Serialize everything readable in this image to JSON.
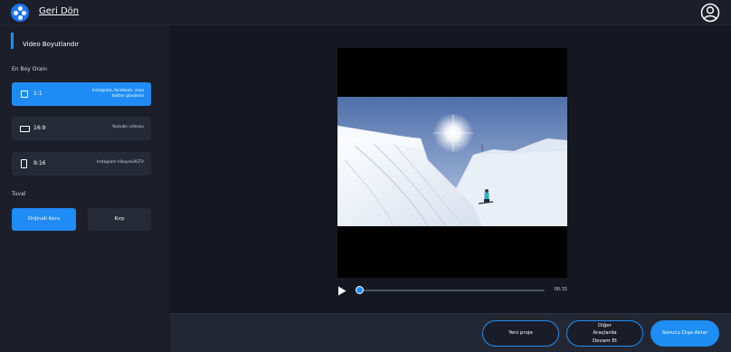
{
  "header": {
    "back_label": "Geri Dön"
  },
  "sidebar": {
    "title": "Video Boyutlandır",
    "aspect_section": "En Boy Oranı",
    "ratios": [
      {
        "label": "1:1",
        "desc": "Instagram, facebook, veya twitter gönderisi",
        "active": true
      },
      {
        "label": "16:9",
        "desc": "Youtube videosu",
        "active": false
      },
      {
        "label": "9:16",
        "desc": "Instagram hikayesi/IGTV",
        "active": false
      }
    ],
    "fill_section": "Tuval",
    "fill_options": [
      "Orijinali Koru",
      "Kırp"
    ]
  },
  "player": {
    "time": "00:15",
    "progress": 0.0
  },
  "footer": {
    "new_project": "Yeni proje",
    "continue_other": "Diğer Araçlarda Devam Et",
    "export": "Sonucu Dışa Aktar"
  },
  "colors": {
    "accent": "#1e8ef5",
    "sidebar": "#1c1f2a",
    "background": "#151821"
  }
}
